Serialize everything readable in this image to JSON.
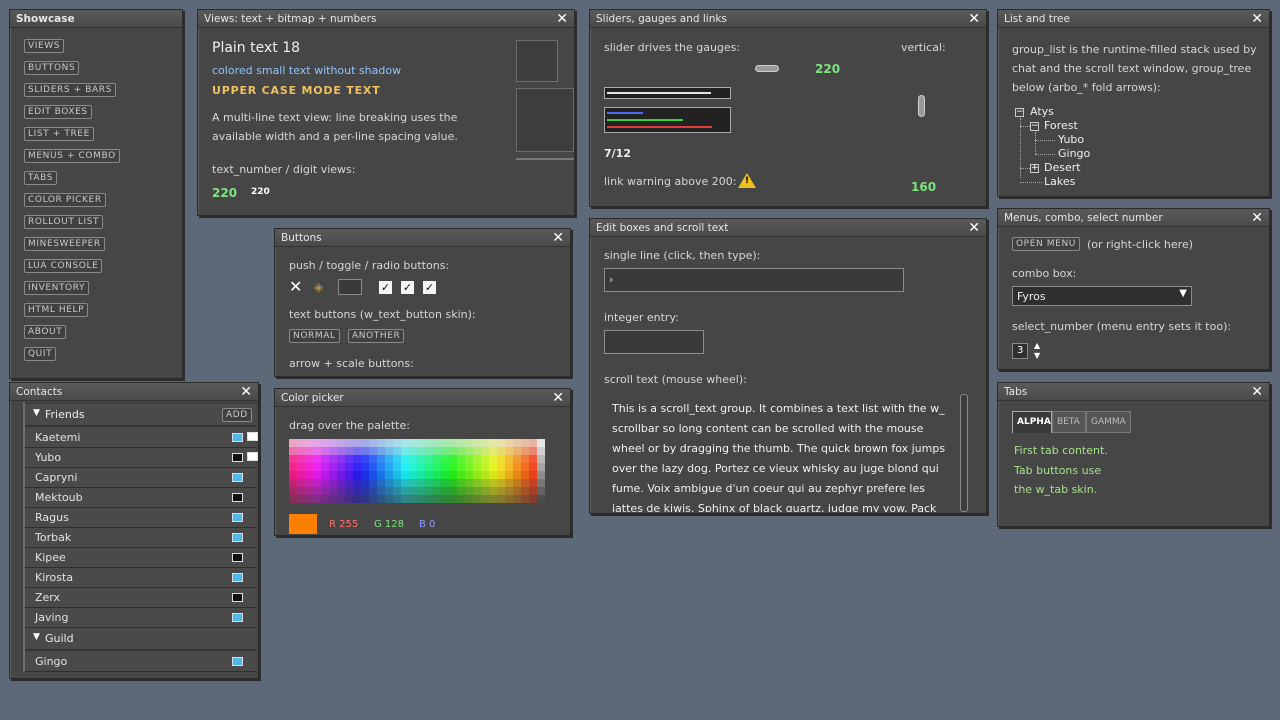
{
  "showcase": {
    "title": "Showcase",
    "items": [
      "VIEWS",
      "BUTTONS",
      "SLIDERS + BARS",
      "EDIT BOXES",
      "LIST + TREE",
      "MENUS + COMBO",
      "TABS",
      "COLOR PICKER",
      "ROLLOUT LIST",
      "MINESWEEPER",
      "LUA CONSOLE",
      "INVENTORY",
      "HTML HELP",
      "ABOUT",
      "QUIT"
    ]
  },
  "views": {
    "title": "Views: text + bitmap + numbers",
    "plain": "Plain text 18",
    "colored": "colored small text without shadow",
    "upper": "UPPER CASE MODE TEXT",
    "multiline": "A multi-line text view: line breaking uses the available width and a per-line spacing value.",
    "numlabel": "text_number / digit views:",
    "num1": "220",
    "num2": "220"
  },
  "sliders": {
    "title": "Sliders, gauges and links",
    "label": "slider drives the gauges:",
    "vertical": "vertical:",
    "value": "220",
    "fraction": "7/12",
    "link": "link warning above 200:",
    "vvalue": "160"
  },
  "listtree": {
    "title": "List and tree",
    "desc": "group_list is the runtime-filled stack used by chat and the scroll text window, group_tree below (arbo_* fold arrows):",
    "nodes": [
      "Atys",
      "Forest",
      "Yubo",
      "Gingo",
      "Desert",
      "Lakes"
    ]
  },
  "buttons": {
    "title": "Buttons",
    "push": "push / toggle / radio buttons:",
    "text": "text buttons (w_text_button skin):",
    "normal": "NORMAL",
    "another": "ANOTHER",
    "arrow": "arrow + scale buttons:"
  },
  "edit": {
    "title": "Edit boxes and scroll text",
    "single": "single line (click, then type):",
    "integer": "integer entry:",
    "scroll": "scroll text (mouse wheel):",
    "body": "This is a scroll_text group.  It combines a text list with the w_ scrollbar so long content can be scrolled with the mouse wheel or by dragging the thumb.  The quick brown fox jumps over the lazy dog.  Portez ce vieux whisky au juge blond qui fume.  Voix ambigue d'un coeur qui au zephyr prefere les jattes de kiwis. Sphinx of black quartz, judge my vow.  Pack my box with five"
  },
  "menus": {
    "title": "Menus, combo, select number",
    "open": "OPEN MENU",
    "hint": "(or right-click here)",
    "combo_label": "combo box:",
    "combo_value": "Fyros",
    "select_label": "select_number (menu entry sets it too):",
    "select_value": "3"
  },
  "contacts": {
    "title": "Contacts",
    "friends": "Friends",
    "add": "ADD",
    "people": [
      "Kaetemi",
      "Yubo",
      "Capryni",
      "Mektoub",
      "Ragus",
      "Torbak",
      "Kipee",
      "Kirosta",
      "Zerx",
      "Javing"
    ],
    "guild": "Guild",
    "guild_people": [
      "Gingo"
    ]
  },
  "color": {
    "title": "Color picker",
    "label": "drag over the palette:",
    "r": "R 255",
    "g": "G 128",
    "b": "B 0",
    "swatch": "#ff8000"
  },
  "tabs": {
    "title": "Tabs",
    "names": [
      "ALPHA",
      "BETA",
      "GAMMA"
    ],
    "line1": "First tab content.",
    "line2": "Tab buttons use",
    "line3": "the w_tab skin."
  }
}
